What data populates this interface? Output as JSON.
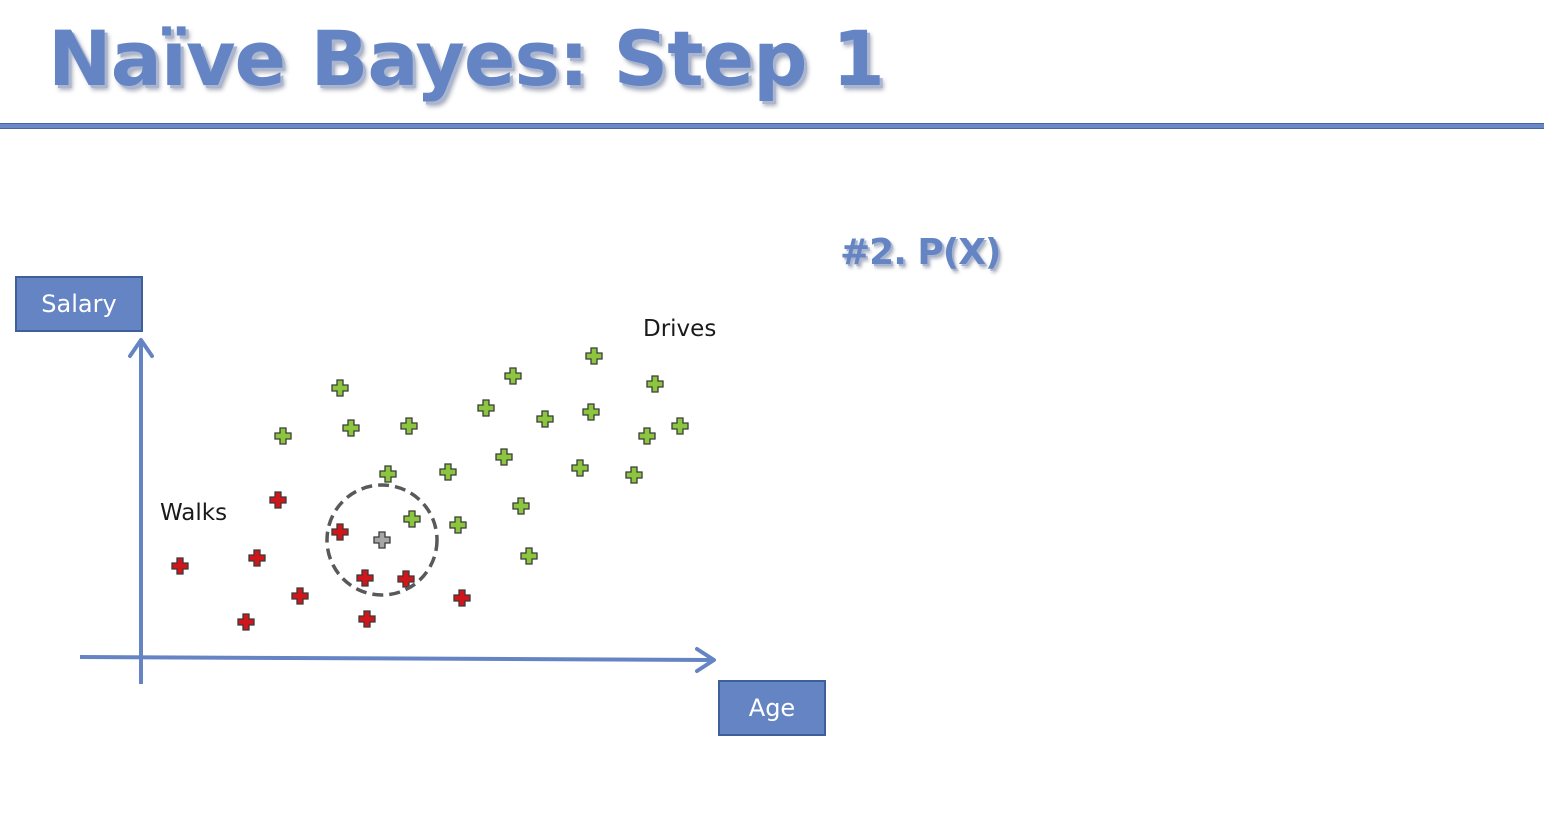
{
  "title": "Naïve Bayes: Step 1",
  "subheading": "#2. P(X)",
  "axes": {
    "y_label": "Salary",
    "x_label": "Age"
  },
  "labels": {
    "walks": "Walks",
    "drives": "Drives"
  },
  "colors": {
    "accent": "#6584c4",
    "walks": "#d0161a",
    "drives": "#8cc63e",
    "new_point": "#a6a6a6",
    "circle": "#595959"
  },
  "chart_data": {
    "type": "scatter",
    "series": [
      {
        "name": "Walks",
        "color": "#d0161a",
        "points": [
          [
            278,
            500
          ],
          [
            180,
            566
          ],
          [
            257,
            558
          ],
          [
            340,
            532
          ],
          [
            300,
            596
          ],
          [
            246,
            622
          ],
          [
            365,
            578
          ],
          [
            406,
            579
          ],
          [
            367,
            619
          ],
          [
            462,
            598
          ]
        ]
      },
      {
        "name": "Drives",
        "color": "#8cc63e",
        "points": [
          [
            340,
            388
          ],
          [
            283,
            436
          ],
          [
            351,
            428
          ],
          [
            409,
            426
          ],
          [
            513,
            376
          ],
          [
            594,
            356
          ],
          [
            655,
            384
          ],
          [
            486,
            408
          ],
          [
            545,
            419
          ],
          [
            591,
            412
          ],
          [
            647,
            436
          ],
          [
            680,
            426
          ],
          [
            504,
            457
          ],
          [
            388,
            474
          ],
          [
            448,
            472
          ],
          [
            580,
            468
          ],
          [
            634,
            475
          ],
          [
            521,
            506
          ],
          [
            412,
            519
          ],
          [
            458,
            525
          ],
          [
            529,
            556
          ]
        ]
      }
    ],
    "new_point": [
      382,
      540
    ],
    "neighborhood": {
      "center": [
        382,
        540
      ],
      "radius": 55
    }
  }
}
